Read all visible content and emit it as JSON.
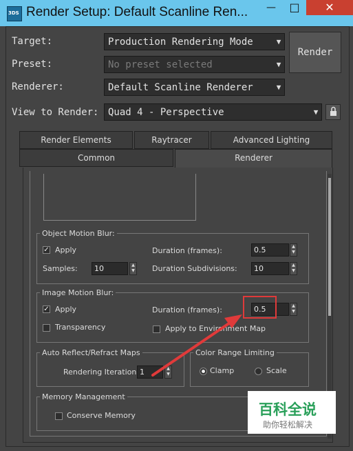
{
  "window": {
    "title": "Render Setup: Default Scanline Ren...",
    "app_icon_text": "3DS",
    "controls": {
      "minimize": "—",
      "maximize": "□",
      "close": "✕"
    }
  },
  "header": {
    "target_label": "Target:",
    "target_value": "Production Rendering Mode",
    "preset_label": "Preset:",
    "preset_placeholder": "No preset selected",
    "renderer_label": "Renderer:",
    "renderer_value": "Default Scanline Renderer",
    "view_label": "View to Render:",
    "view_value": "Quad 4 - Perspective",
    "render_button": "Render"
  },
  "tabs": {
    "row1": [
      "Render Elements",
      "Raytracer",
      "Advanced Lighting"
    ],
    "row2": [
      "Common",
      "Renderer"
    ],
    "active": "Renderer"
  },
  "object_motion_blur": {
    "title": "Object Motion Blur:",
    "apply_label": "Apply",
    "apply_checked": true,
    "duration_label": "Duration (frames):",
    "duration_value": "0.5",
    "samples_label": "Samples:",
    "samples_value": "10",
    "subdiv_label": "Duration Subdivisions:",
    "subdiv_value": "10"
  },
  "image_motion_blur": {
    "title": "Image Motion Blur:",
    "apply_label": "Apply",
    "apply_checked": true,
    "duration_label": "Duration (frames):",
    "duration_value": "0.5",
    "transparency_label": "Transparency",
    "transparency_checked": false,
    "env_label": "Apply to Environment Map",
    "env_checked": false
  },
  "auto_reflect": {
    "title": "Auto Reflect/Refract Maps",
    "iterations_label": "Rendering Iterations:",
    "iterations_value": "1"
  },
  "color_range": {
    "title": "Color Range Limiting",
    "options": [
      "Clamp",
      "Scale"
    ],
    "selected": "Clamp"
  },
  "memory": {
    "title": "Memory Management",
    "conserve_label": "Conserve Memory",
    "conserve_checked": false
  },
  "watermark": {
    "main": "百科全说",
    "sub": "助你轻松解决"
  },
  "colors": {
    "titlebar": "#6ac6ec",
    "panel": "#444444",
    "annotation": "#e03a3a"
  }
}
